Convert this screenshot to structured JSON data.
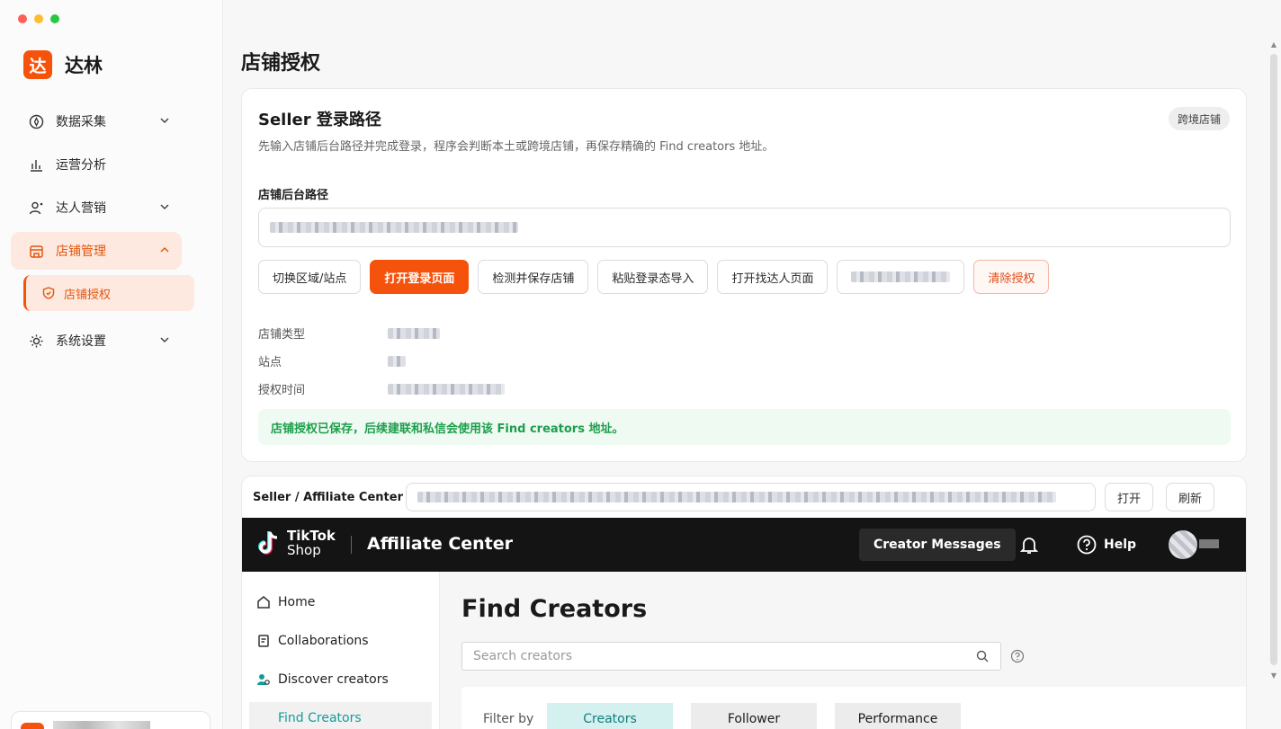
{
  "colors": {
    "accent": "#f5520c",
    "success": "#1e9e4c",
    "tiktok_teal": "#109d9a"
  },
  "app": {
    "name": "达林",
    "logo_char": "达"
  },
  "sidebar": {
    "items": [
      {
        "label": "数据采集",
        "icon": "compass-icon",
        "expandable": true
      },
      {
        "label": "运营分析",
        "icon": "bar-chart-icon",
        "expandable": false
      },
      {
        "label": "达人营销",
        "icon": "user-icon",
        "expandable": true
      },
      {
        "label": "店铺管理",
        "icon": "store-icon",
        "expandable": true,
        "active": true
      },
      {
        "label": "系统设置",
        "icon": "gear-icon",
        "expandable": true
      }
    ],
    "sub_item": {
      "label": "店铺授权",
      "icon": "shield-icon"
    }
  },
  "page": {
    "title": "店铺授权"
  },
  "seller_card": {
    "title": "Seller 登录路径",
    "badge": "跨境店铺",
    "description": "先输入店铺后台路径并完成登录，程序会判断本土或跨境店铺，再保存精确的 Find creators 地址。",
    "field_label": "店铺后台路径",
    "buttons": {
      "switch_region": "切换区域/站点",
      "open_login": "打开登录页面",
      "detect_save": "检测并保存店铺",
      "paste_import": "粘贴登录态导入",
      "open_find": "打开找达人页面",
      "clear_auth": "清除授权"
    },
    "info_labels": {
      "store_type": "店铺类型",
      "site": "站点",
      "auth_time": "授权时间"
    },
    "notice": "店铺授权已保存，后续建联和私信会使用该 Find creators 地址。"
  },
  "browser": {
    "address_label": "Seller / Affiliate Center",
    "open_button": "打开",
    "refresh_button": "刷新"
  },
  "tiktok": {
    "logo_line1": "TikTok",
    "logo_line2": "Shop",
    "title": "Affiliate Center",
    "creator_messages": "Creator Messages",
    "help": "Help",
    "side_items": {
      "home": "Home",
      "collaborations": "Collaborations",
      "discover": "Discover creators",
      "find": "Find Creators"
    },
    "find_title": "Find Creators",
    "search_placeholder": "Search creators",
    "filter_label": "Filter by",
    "chips": {
      "creators": "Creators",
      "follower": "Follower",
      "performance": "Performance"
    }
  }
}
